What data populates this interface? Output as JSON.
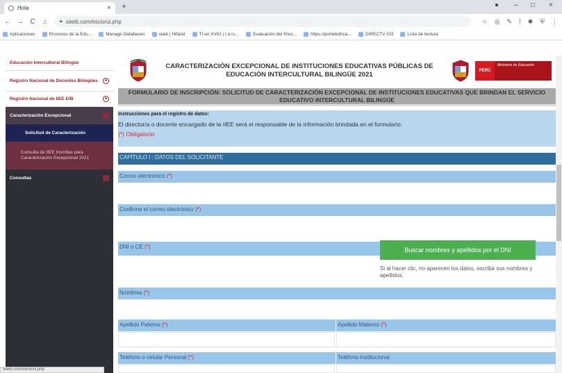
{
  "browser": {
    "tab_title": "Hola",
    "url": "siieib.com/inicio/ui.php",
    "bookmarks": [
      "Aplicaciones",
      "Procesos de la Edu...",
      "Manage Databases",
      "siieb | Hifaret",
      "TI en XVIO | t a ru...",
      "Evaluación del Ríus...",
      "https://portaledrica...",
      "DIRECTV GO",
      "Lista de lectura"
    ]
  },
  "sidebar": {
    "items": [
      {
        "label": "Educación Intercultural Bilingüe"
      },
      {
        "label": "Registro Nacional de Docentes Bilingües"
      },
      {
        "label": "Registro Nacional de IIEE EIB"
      },
      {
        "label": "Caracterización Excepcional"
      },
      {
        "label": "Solicitud de Caracterización"
      },
      {
        "label": "Consulta de IIEE Inscritas para Caracterización Excepcional 2021"
      },
      {
        "label": "Consultas"
      }
    ]
  },
  "header": {
    "title": "CARACTERIZACIÓN EXCEPCIONAL DE INSTITUCIONES EDUCATIVAS PÚBLICAS DE EDUCACIÓN INTERCULTURAL BILINGÜE 2021",
    "gov_short": "PERÚ",
    "gov_ministry": "Ministerio de Educación"
  },
  "form": {
    "heading": "FORMULARIO DE INSCRIPCIÓN: SOLICITUD DE CARACTERIZACIÓN EXCEPCIONAL DE INSTITUCIONES EDUCATIVAS QUE BRINDAN EL SERVICIO EDUCATIVO INTERCULTURAL BILINGÜE",
    "instructions_title": "Instrucciones para el registro de datos:",
    "instructions_text": "El director/a o docente encargado de la IIEE será el responsable de la información brindada en el formulario.",
    "required_note": "(*) Obligatorio",
    "chapter": "CAPÍTULO I : DATOS DEL SOLICITANTE",
    "required_mark": "(*)",
    "fields": {
      "email": "Correo electrónico",
      "email_confirm": "Confirme el correo electrónico",
      "dni": "DNI o CE",
      "names": "Nombres",
      "paternal": "Apellido Paterno",
      "maternal": "Apellido Materno",
      "phone_personal": "Teléfono o celular Personal",
      "phone_inst": "Teléfono Institucional"
    },
    "search_button": "Buscar nombres y apellidos por el DNI",
    "search_hint": "Si al hacer clic, no aparecen los datos, escriba sus nombres y apellidos."
  }
}
